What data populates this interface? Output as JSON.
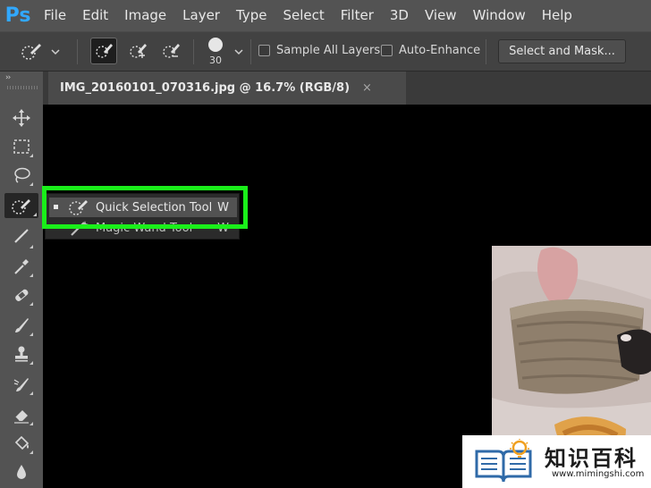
{
  "app": {
    "logo": "Ps"
  },
  "menu": [
    "File",
    "Edit",
    "Image",
    "Layer",
    "Type",
    "Select",
    "Filter",
    "3D",
    "View",
    "Window",
    "Help"
  ],
  "options": {
    "brush_size": "30",
    "sample_all_layers_label": "Sample All Layers",
    "sample_all_layers_checked": false,
    "auto_enhance_label": "Auto-Enhance",
    "auto_enhance_checked": false,
    "select_and_mask_label": "Select and Mask..."
  },
  "document": {
    "tab_title": "IMG_20160101_070316.jpg @ 16.7% (RGB/8)",
    "close_glyph": "×"
  },
  "toolbar": {
    "collapse_glyph": "››",
    "tools": [
      "move-tool",
      "marquee-tool",
      "lasso-tool",
      "quick-selection-tool",
      "crop-tool",
      "eyedropper-tool",
      "healing-brush-tool",
      "brush-tool",
      "clone-stamp-tool",
      "history-brush-tool",
      "eraser-tool",
      "paint-bucket-tool",
      "blur-tool"
    ]
  },
  "flyout": {
    "items": [
      {
        "label": "Quick Selection Tool",
        "shortcut": "W",
        "selected": true
      },
      {
        "label": "Magic Wand Tool",
        "shortcut": "W",
        "selected": false
      }
    ]
  },
  "watermark": {
    "text": "知识百科",
    "url": "www.mimingshi.com"
  },
  "colors": {
    "accent_ps": "#31a8ff",
    "highlight_border": "#1aef1a",
    "menubar": "#535353",
    "optionsbar": "#424242"
  }
}
